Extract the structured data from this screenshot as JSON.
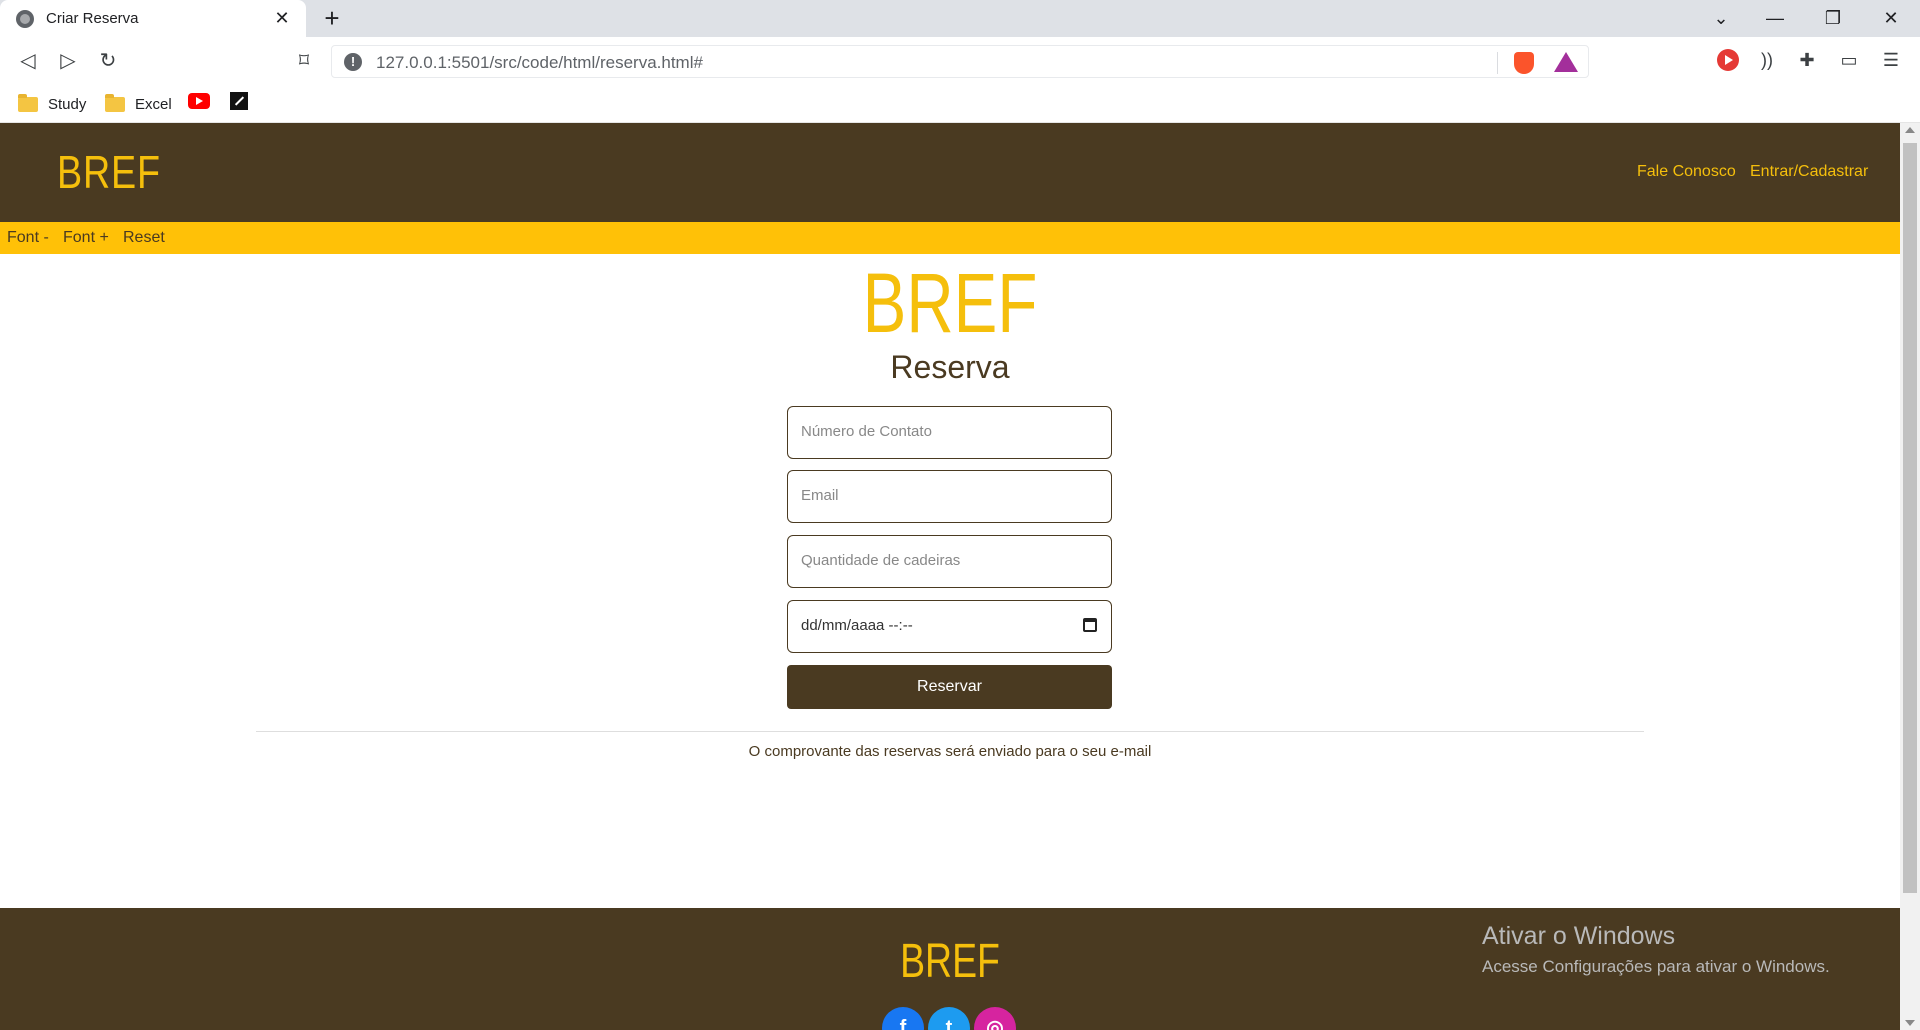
{
  "browser": {
    "tab_title": "Criar Reserva",
    "tab_close": "✕",
    "new_tab": "+",
    "url": "127.0.0.1:5501/src/code/html/reserva.html#",
    "bookmarks": [
      {
        "label": "Study",
        "icon": "folder-icon"
      },
      {
        "label": "Excel",
        "icon": "folder-icon"
      }
    ]
  },
  "header": {
    "logo": "BREF",
    "nav": [
      {
        "label": "Fale Conosco"
      },
      {
        "label": "Entrar/Cadastrar"
      }
    ]
  },
  "accessibility": {
    "font_minus": "Font -",
    "font_plus": "Font +",
    "reset": "Reset"
  },
  "form": {
    "logo": "BREF",
    "heading": "Reserva",
    "phone_placeholder": "Número de Contato",
    "email_placeholder": "Email",
    "chairs_placeholder": "Quantidade de cadeiras",
    "datetime_value": "dd/mm/aaaa --:--",
    "submit_label": "Reservar",
    "notice": "O comprovante das reservas será enviado para o seu e-mail"
  },
  "footer": {
    "logo": "BREF",
    "social": [
      {
        "name": "facebook",
        "glyph": "f"
      },
      {
        "name": "twitter",
        "glyph": "t"
      },
      {
        "name": "instagram",
        "glyph": "◎"
      }
    ]
  },
  "windows_watermark": {
    "title": "Ativar o Windows",
    "subtitle": "Acesse Configurações para ativar o Windows."
  },
  "colors": {
    "brand_brown": "#4a3a21",
    "brand_yellow": "#f5bf0c",
    "access_bar": "#ffc107"
  }
}
